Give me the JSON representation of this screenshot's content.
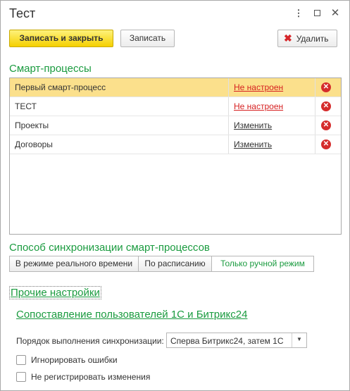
{
  "window": {
    "title": "Тест",
    "controls": {
      "more": "⋮",
      "maximize": "",
      "close": "✕"
    }
  },
  "toolbar": {
    "save_close_label": "Записать и закрыть",
    "save_label": "Записать",
    "delete_label": "Удалить"
  },
  "smart_processes": {
    "title": "Смарт-процессы",
    "rows": [
      {
        "name": "Первый смарт-процесс",
        "status": "Не настроен",
        "selected": true
      },
      {
        "name": "ТЕСТ",
        "status": "Не настроен",
        "selected": false
      },
      {
        "name": "Проекты",
        "status": "Изменить",
        "selected": false
      },
      {
        "name": "Договоры",
        "status": "Изменить",
        "selected": false
      }
    ]
  },
  "sync_method": {
    "title": "Способ синхронизации смарт-процессов",
    "options": [
      "В режиме реального времени",
      "По расписанию",
      "Только ручной режим"
    ],
    "selected": "Только ручной режим"
  },
  "other_settings": {
    "title": "Прочие настройки",
    "user_mapping_link": "Сопоставление пользователей 1С и Битрикс24",
    "order_label": "Порядок выполнения синхронизации:",
    "order_value": "Сперва Битрикс24, затем 1С",
    "ignore_errors_label": "Игнорировать ошибки",
    "no_register_label": "Не регистрировать изменения"
  },
  "colors": {
    "accent_green": "#1a9b3f",
    "primary_yellow": "#f5d000",
    "selected_row": "#fbe08c",
    "link_red": "#d62020",
    "delete_red": "#d52c2c"
  }
}
